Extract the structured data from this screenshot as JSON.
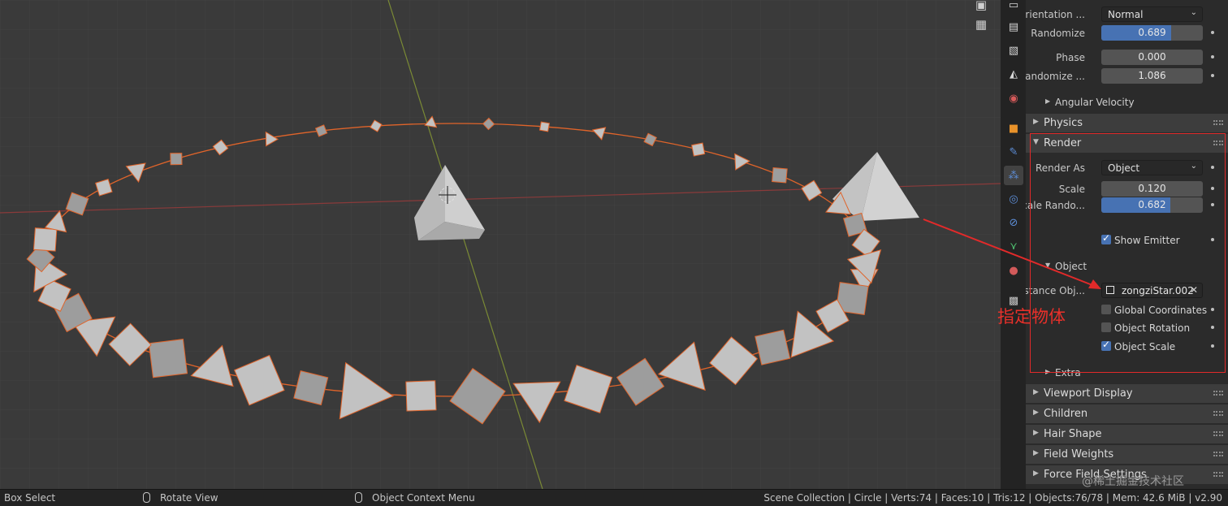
{
  "viewport": {
    "tools": [
      "camera-icon",
      "grid-icon"
    ]
  },
  "properties": {
    "orientation": {
      "label": "Orientation ...",
      "value": "Normal"
    },
    "randomize1": {
      "label": "Randomize",
      "value": "0.689",
      "fraction": 0.689
    },
    "phase": {
      "label": "Phase",
      "value": "0.000",
      "fraction": 0.0
    },
    "randomize2": {
      "label": "Randomize ...",
      "value": "1.086",
      "fraction": 0.0
    },
    "angular_velocity": "Angular Velocity",
    "physics": "Physics",
    "render": "Render",
    "render_as": {
      "label": "Render As",
      "value": "Object"
    },
    "scale": {
      "label": "Scale",
      "value": "0.120",
      "fraction": 0.12
    },
    "scale_random": {
      "label": "Scale Rando...",
      "value": "0.682",
      "fraction": 0.682
    },
    "show_emitter": {
      "label": "Show Emitter",
      "checked": true
    },
    "object_sub": "Object",
    "instance_obj": {
      "label": "Instance Obj...",
      "value": "zongziStar.002"
    },
    "global_coordinates": {
      "label": "Global Coordinates",
      "checked": false
    },
    "object_rotation": {
      "label": "Object Rotation",
      "checked": false
    },
    "object_scale": {
      "label": "Object Scale",
      "checked": true
    },
    "extra": "Extra",
    "viewport_display": "Viewport Display",
    "children": "Children",
    "hair_shape": "Hair Shape",
    "field_weights": "Field Weights",
    "force_field": "Force Field Settings"
  },
  "annotation": {
    "text": "指定物体",
    "color": "#e8302a"
  },
  "watermark": "@稀土掘金技术社区",
  "statusbar": {
    "box_select": "Box Select",
    "rotate_view": "Rotate View",
    "context_menu": "Object Context Menu",
    "stats": "Scene Collection | Circle | Verts:74 | Faces:10 | Tris:12 | Objects:76/78 | Mem: 42.6 MiB | v2.90"
  },
  "colors": {
    "accent": "#4772b3",
    "highlight": "#e22a2a",
    "selection": "#e0642a"
  }
}
